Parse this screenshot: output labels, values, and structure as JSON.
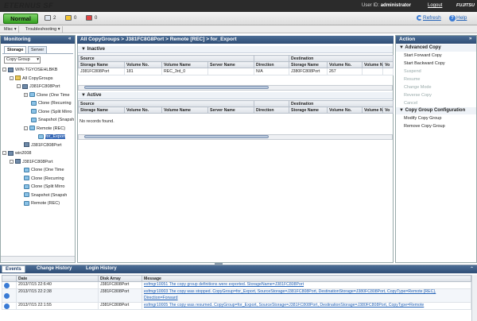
{
  "header": {
    "logo": "ETERNUS SF",
    "userid_label": "User ID:",
    "userid": "administrator",
    "logout": "Logout",
    "brand": "FUJITSU"
  },
  "status": {
    "state": "Normal",
    "counts": [
      "2",
      "0",
      "0"
    ],
    "refresh": "Refresh",
    "help": "Help"
  },
  "menu": [
    "Misc",
    "Troubleshooting"
  ],
  "monitoring": {
    "title": "Monitoring",
    "tabs": [
      "Storage",
      "Server"
    ],
    "select": "Copy Group",
    "tree": [
      {
        "label": "WIN-TGYOSEHLBKB",
        "indent": 0,
        "icon": "server",
        "exp": "-"
      },
      {
        "label": "All CopyGroups",
        "indent": 1,
        "icon": "group",
        "exp": "-"
      },
      {
        "label": "J381FC808Port",
        "indent": 2,
        "icon": "server",
        "exp": "-"
      },
      {
        "label": "Clone (One Time",
        "indent": 3,
        "icon": "copy",
        "exp": "+"
      },
      {
        "label": "Clone (Recurring",
        "indent": 3,
        "icon": "copy",
        "exp": ""
      },
      {
        "label": "Clone (Split Mirro",
        "indent": 3,
        "icon": "copy",
        "exp": ""
      },
      {
        "label": "Snapshot (Snapsh",
        "indent": 3,
        "icon": "copy",
        "exp": ""
      },
      {
        "label": "Remote (REC)",
        "indent": 3,
        "icon": "copy",
        "exp": "-"
      },
      {
        "label": "for_Export",
        "indent": 4,
        "icon": "copy",
        "exp": "",
        "selected": true
      },
      {
        "label": "J381FC808Port",
        "indent": 2,
        "icon": "server",
        "exp": ""
      },
      {
        "label": "win2008",
        "indent": 0,
        "icon": "server",
        "exp": "-"
      },
      {
        "label": "J381FC808Port",
        "indent": 1,
        "icon": "server",
        "exp": "-"
      },
      {
        "label": "Clone (One Time",
        "indent": 2,
        "icon": "copy",
        "exp": ""
      },
      {
        "label": "Clone (Recurring",
        "indent": 2,
        "icon": "copy",
        "exp": ""
      },
      {
        "label": "Clone (Split Mirro",
        "indent": 2,
        "icon": "copy",
        "exp": ""
      },
      {
        "label": "Snapshot (Snapsh",
        "indent": 2,
        "icon": "copy",
        "exp": ""
      },
      {
        "label": "Remote (REC)",
        "indent": 2,
        "icon": "copy",
        "exp": ""
      }
    ]
  },
  "main": {
    "breadcrumb": "All CopyGroups > J381FC8G8Port > Remote [REC] > for_Export",
    "inactive": {
      "title": "Inactive",
      "source": "Source",
      "destination": "Destination",
      "cols": [
        "Storage Name",
        "Volume No.",
        "Volume Name",
        "Server Name",
        "Direction",
        "Storage Name",
        "Volume No.",
        "Volume Name",
        "Vo"
      ],
      "rows": [
        [
          "J381FC808Port",
          "181",
          "REC_3rd_0",
          "",
          "N/A",
          "J380FC808Port",
          "267",
          "",
          ""
        ]
      ]
    },
    "active": {
      "title": "Active",
      "source": "Source",
      "destination": "Destination",
      "cols": [
        "Storage Name",
        "Volume No.",
        "Volume Name",
        "Server Name",
        "Direction",
        "Storage Name",
        "Volume No.",
        "Volume Name",
        "Vo"
      ],
      "empty": "No records found."
    }
  },
  "action": {
    "title": "Action",
    "groups": [
      {
        "title": "Advanced Copy",
        "items": [
          {
            "label": "Start Forward Copy",
            "enabled": true
          },
          {
            "label": "Start Backward Copy",
            "enabled": true
          },
          {
            "label": "Suspend",
            "enabled": false
          },
          {
            "label": "Resume",
            "enabled": false
          },
          {
            "label": "Change Mode",
            "enabled": false
          },
          {
            "label": "Reverse Copy",
            "enabled": false
          },
          {
            "label": "Cancel",
            "enabled": false
          }
        ]
      },
      {
        "title": "Copy Group Configuration",
        "items": [
          {
            "label": "Modify Copy Group",
            "enabled": true
          },
          {
            "label": "Remove Copy Group",
            "enabled": true
          }
        ]
      }
    ]
  },
  "bottom": {
    "tabs": [
      "Events",
      "Change History",
      "Login History"
    ],
    "cols": [
      "Date",
      "Disk Array",
      "Message"
    ],
    "rows": [
      {
        "date": "2013/7/15 22:6:40",
        "array": "J381FC808Port",
        "msg": "esfmgr10051 The copy group definitions were exported. StorageName=J381FC808Port"
      },
      {
        "date": "2013/7/15 22:2:38",
        "array": "J381FC808Port",
        "msg": "esfmgr10003 The copy was stopped. CopyGroup=for_Export, SourceStorage=J381FC808Port, DestinationStorage=J380FC808Port, CopyType=Remote [REC], Direction=Forward"
      },
      {
        "date": "2013/7/15 22:1:55",
        "array": "J381FC808Port",
        "msg": "esfmgr10005 The copy was resumed. CopyGroup=for_Export, SourceStorage=J381FC808Port, DestinationStorage=J380FC808Port, CopyType=Remote"
      }
    ]
  }
}
